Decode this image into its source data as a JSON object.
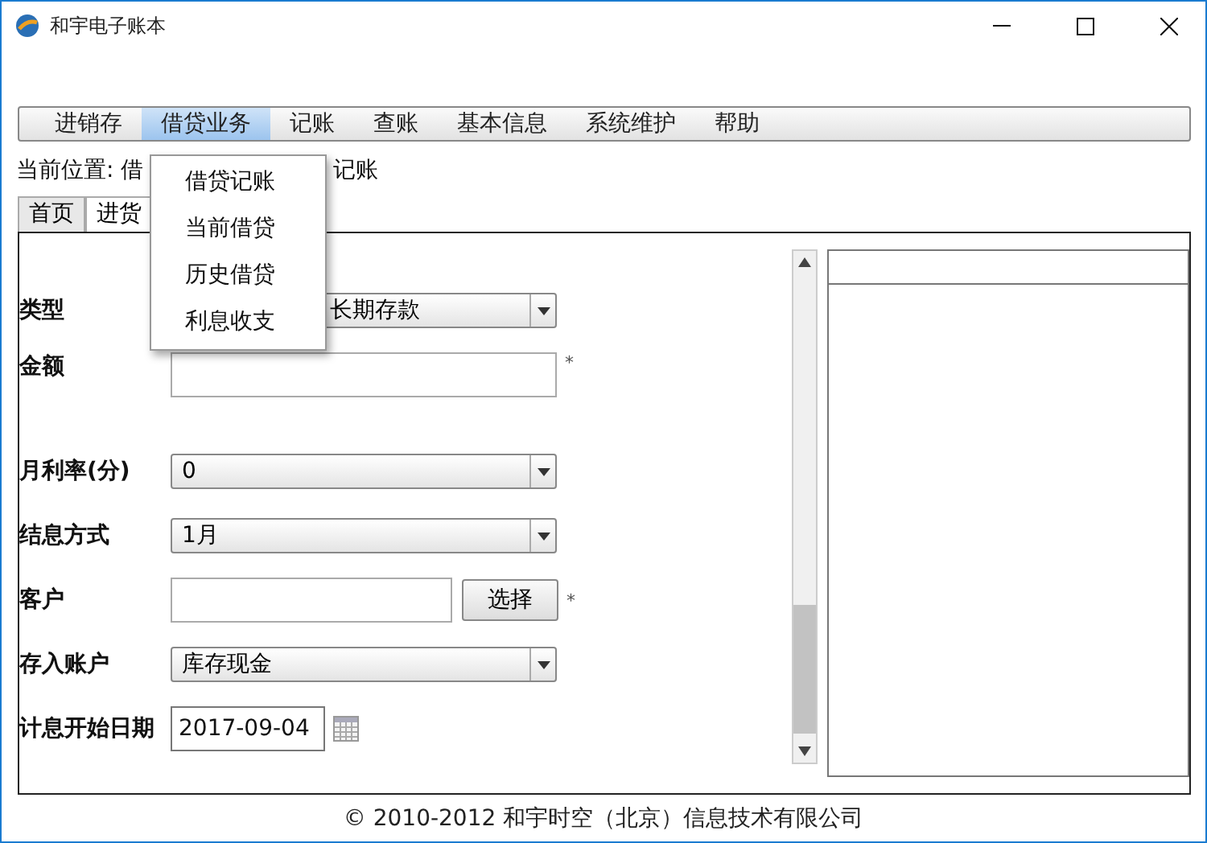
{
  "window": {
    "title": "和宇电子账本"
  },
  "menu": [
    {
      "label": "进销存",
      "selected": false
    },
    {
      "label": "借贷业务",
      "selected": true
    },
    {
      "label": "记账",
      "selected": false
    },
    {
      "label": "查账",
      "selected": false
    },
    {
      "label": "基本信息",
      "selected": false
    },
    {
      "label": "系统维护",
      "selected": false
    },
    {
      "label": "帮助",
      "selected": false
    }
  ],
  "dropdown": [
    "借贷记账",
    "当前借贷",
    "历史借贷",
    "利息收支"
  ],
  "breadcrumb": {
    "before": "当前位置: 借",
    "after": "记账"
  },
  "tabs": [
    {
      "label": "首页",
      "selected": false
    },
    {
      "label": "进货",
      "selected": true
    }
  ],
  "form": [
    {
      "kind": "select-covered",
      "label": "类型",
      "value": "长期存款"
    },
    {
      "kind": "input",
      "label": "金额",
      "note": "*"
    },
    {
      "kind": "select",
      "label": "月利率(分)",
      "value": "0"
    },
    {
      "kind": "select",
      "label": "结息方式",
      "value": "1月"
    },
    {
      "kind": "pick",
      "label": "客户",
      "button": "选择",
      "note": "*"
    },
    {
      "kind": "select",
      "label": "存入账户",
      "value": "库存现金"
    },
    {
      "kind": "date",
      "label": "计息开始日期",
      "value": "2017-09-04"
    }
  ],
  "footer": "© 2010-2012  和宇时空（北京）信息技术有限公司"
}
